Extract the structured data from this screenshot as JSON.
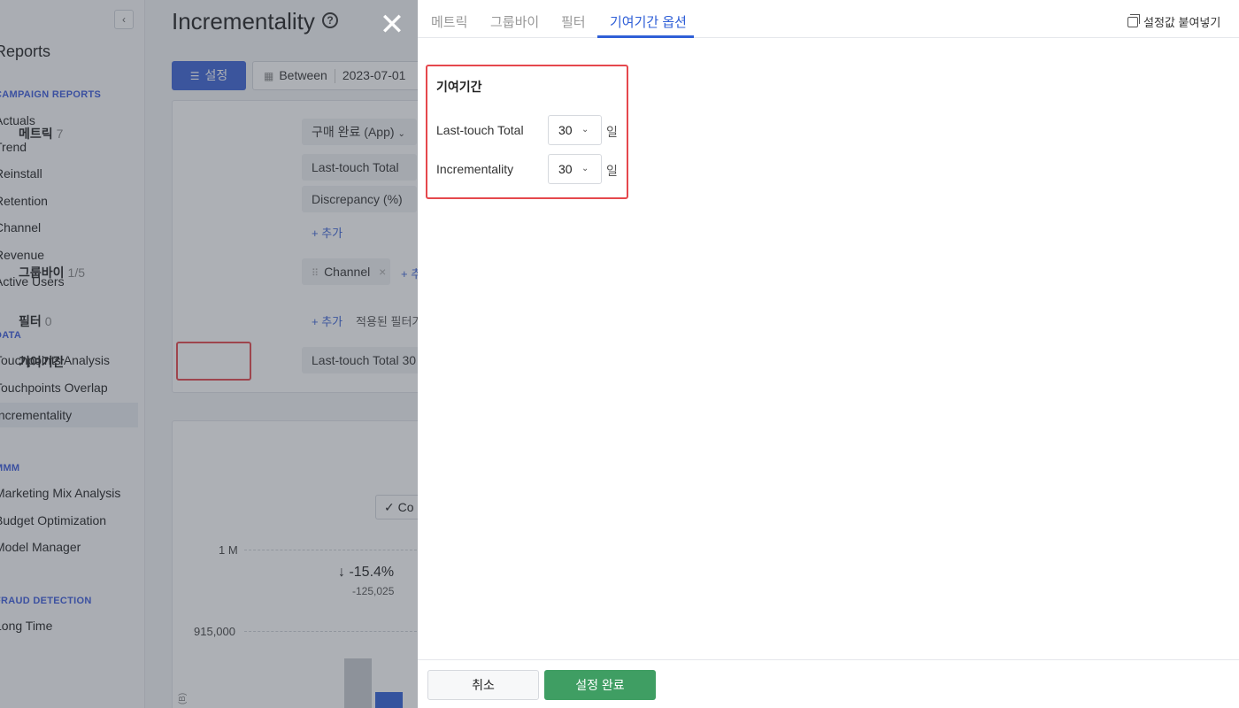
{
  "sidebar": {
    "collapse_icon": "‹",
    "title": "Reports",
    "sections": [
      {
        "label": "CAMPAIGN REPORTS"
      },
      {
        "label": "DATA"
      },
      {
        "label": "MMM"
      },
      {
        "label": "FRAUD DETECTION"
      }
    ],
    "items": [
      {
        "label": "Actuals"
      },
      {
        "label": "Trend"
      },
      {
        "label": "Reinstall"
      },
      {
        "label": "Retention"
      },
      {
        "label": "Channel"
      },
      {
        "label": "Revenue"
      },
      {
        "label": "Active Users"
      },
      {
        "label": "Touchpoints Analysis"
      },
      {
        "label": "Touchpoints Overlap"
      },
      {
        "label": "Incrementality"
      },
      {
        "label": "Marketing Mix Analysis"
      },
      {
        "label": "Budget Optimization"
      },
      {
        "label": "Model Manager"
      },
      {
        "label": "Long Time"
      }
    ]
  },
  "main": {
    "title": "Incrementality",
    "help_icon": "?",
    "settings_label": "설정",
    "date_mode": "Between",
    "date_start": "2023-07-01"
  },
  "config": {
    "metric_label": "메트릭",
    "metric_count": "7",
    "metric_select": "구매 완료 (App)",
    "metric_chips": [
      "Last-touch Total",
      "Discrepancy (%)"
    ],
    "add_label": "+ 추가",
    "groupby_label": "그룹바이",
    "groupby_count": "1/5",
    "groupby_chip": "Channel",
    "groupby_add": "+ 추",
    "filter_label": "필터",
    "filter_count": "0",
    "filter_add": "+ 추가",
    "filter_applied": "적용된 필터가",
    "attribution_label": "기여기간",
    "attribution_chip": "Last-touch Total 30"
  },
  "chart": {
    "compare_chip": "✓ Co",
    "tick_top": "1 M",
    "tick_mid": "915,000",
    "delta": "↓ -15.4%",
    "delta_sub": "-125,025",
    "y_axis_fragment": "(B)",
    "bar_colors": [
      "#c8cbd0",
      "#2f5fd7"
    ]
  },
  "drawer": {
    "close_icon": "✕",
    "tabs": [
      {
        "label": "메트릭"
      },
      {
        "label": "그룹바이"
      },
      {
        "label": "필터"
      },
      {
        "label": "기여기간 옵션"
      }
    ],
    "paste_label": "설정값 붙여넣기",
    "attribution": {
      "title": "기여기간",
      "rows": [
        {
          "label": "Last-touch Total",
          "value": "30",
          "unit": "일"
        },
        {
          "label": "Incrementality",
          "value": "30",
          "unit": "일"
        }
      ]
    },
    "cancel_label": "취소",
    "done_label": "설정 완료"
  },
  "colors": {
    "accent": "#2f5fd7",
    "highlight": "#e5484d",
    "confirm": "#3f9e63"
  }
}
